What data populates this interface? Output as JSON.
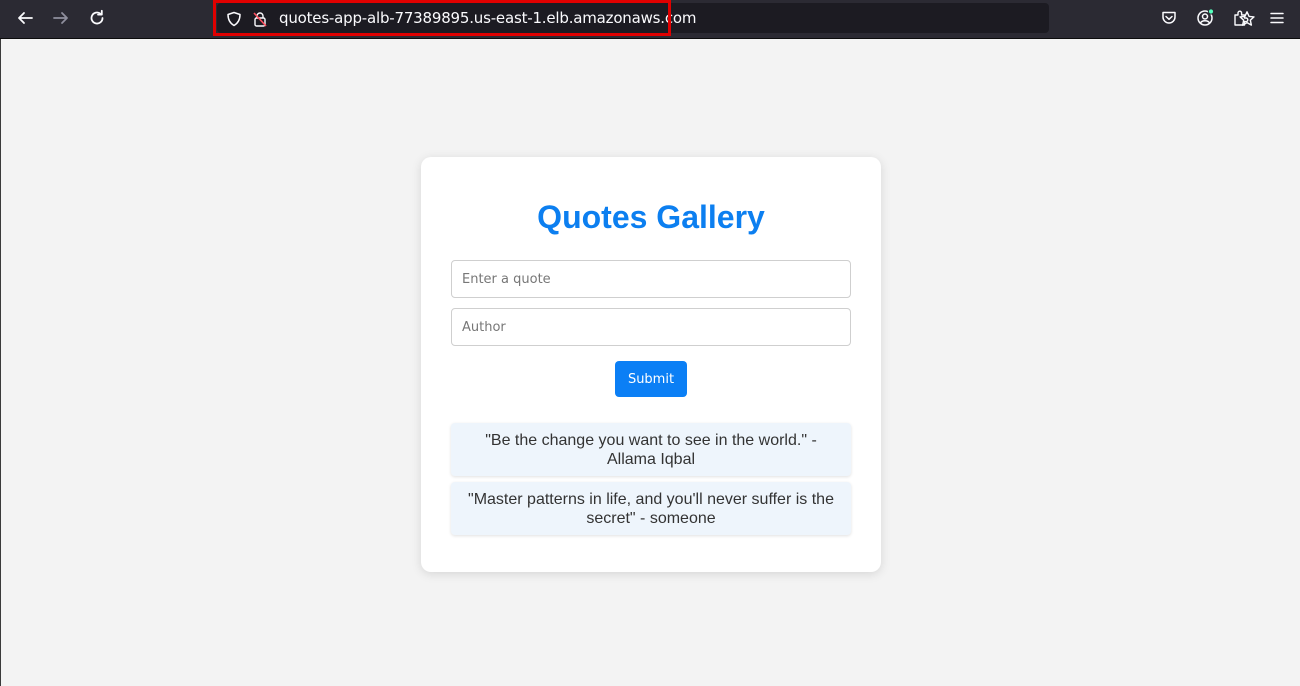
{
  "browser": {
    "url": "quotes-app-alb-77389895.us-east-1.elb.amazonaws.com",
    "icons": {
      "back": "back-arrow-icon",
      "forward": "forward-arrow-icon",
      "reload": "reload-icon",
      "shield": "tracking-shield-icon",
      "lock": "insecure-lock-icon",
      "bookmark": "bookmark-star-icon",
      "pocket": "pocket-icon",
      "account": "account-icon",
      "extensions": "extensions-icon",
      "menu": "hamburger-menu-icon"
    },
    "highlight_color": "#e00000"
  },
  "page": {
    "title": "Quotes Gallery",
    "title_color": "#0c7ff0",
    "quote_input": {
      "placeholder": "Enter a quote",
      "value": ""
    },
    "author_input": {
      "placeholder": "Author",
      "value": ""
    },
    "submit_label": "Submit",
    "button_color": "#0b7ff5",
    "quotes": [
      {
        "text": "\"Be the change you want to see in the world.\" - Allama Iqbal"
      },
      {
        "text": "\"Master patterns in life, and you'll never suffer is the secret\" - someone"
      }
    ]
  }
}
